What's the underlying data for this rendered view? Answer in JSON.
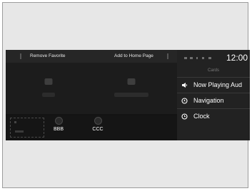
{
  "toolbar": {
    "remove_favorite_label": "Remove Favorite",
    "add_home_page_label": "Add to Home Page"
  },
  "dock": {
    "items": [
      {
        "label": "BBB"
      },
      {
        "label": "CCC"
      }
    ]
  },
  "status": {
    "clock": "12:00"
  },
  "panel": {
    "title": "Cards",
    "cards": [
      {
        "label": "Now Playing Aud",
        "icon": "speaker-icon"
      },
      {
        "label": "Navigation",
        "icon": "navigation-icon"
      },
      {
        "label": "Clock",
        "icon": "clock-icon"
      }
    ]
  },
  "colors": {
    "background": "#e7e7e7",
    "screen": "#1b1b1b",
    "text": "#ffffff"
  }
}
